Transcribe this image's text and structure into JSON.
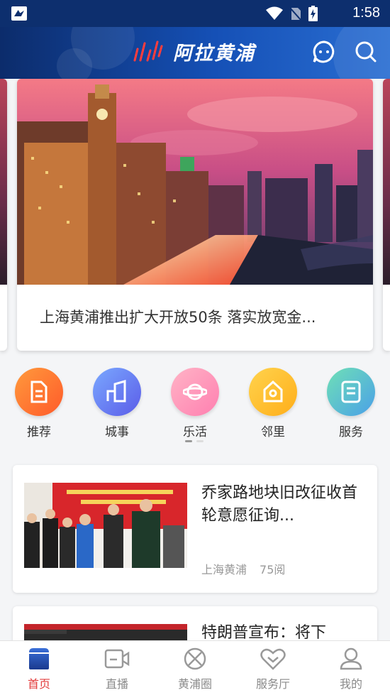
{
  "status_bar": {
    "time": "1:58"
  },
  "header": {
    "title": "阿拉黄浦"
  },
  "carousel": {
    "caption": "上海黄浦推出扩大开放50条 落实放宽金..."
  },
  "categories": [
    {
      "label": "推荐",
      "color_from": "#ff9a3c",
      "color_to": "#ff5a2a"
    },
    {
      "label": "城事",
      "color_from": "#7aa8ff",
      "color_to": "#5b5ce8"
    },
    {
      "label": "乐活",
      "color_from": "#ffb4c6",
      "color_to": "#ff7fb0"
    },
    {
      "label": "邻里",
      "color_from": "#ffd34d",
      "color_to": "#ffae1a"
    },
    {
      "label": "服务",
      "color_from": "#6fe0b6",
      "color_to": "#4aa0e8"
    }
  ],
  "news": [
    {
      "headline": "乔家路地块旧改征收首轮意愿征询...",
      "source": "上海黄浦",
      "reads": "75阅"
    },
    {
      "headline": "特朗普宣布：将下",
      "source": "",
      "reads": ""
    }
  ],
  "bottom_nav": [
    {
      "label": "首页",
      "icon": "home-icon",
      "active": true
    },
    {
      "label": "直播",
      "icon": "video-icon",
      "active": false
    },
    {
      "label": "黄浦圈",
      "icon": "circle-icon",
      "active": false
    },
    {
      "label": "服务厅",
      "icon": "heart-hand-icon",
      "active": false
    },
    {
      "label": "我的",
      "icon": "user-icon",
      "active": false
    }
  ],
  "colors": {
    "header_dark": "#0c2c6b",
    "header_light": "#2a6ed2",
    "active_nav": "#e23b3b"
  }
}
